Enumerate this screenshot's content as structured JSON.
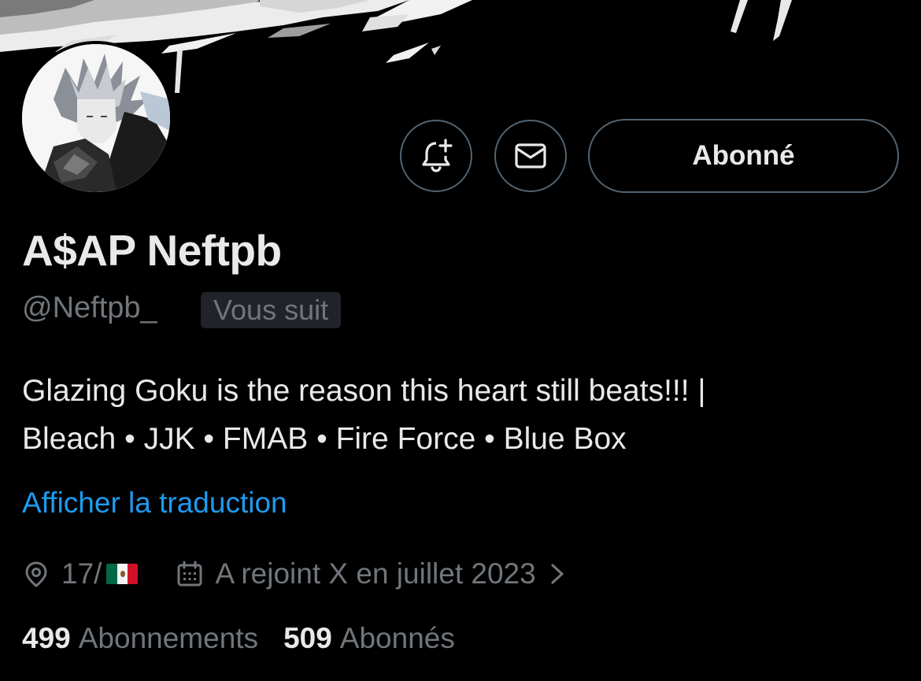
{
  "profile": {
    "display_name": "A$AP Neftpb",
    "handle": "@Neftpb_",
    "follows_you_badge": "Vous suit",
    "bio_line1": "Glazing Goku is the reason this heart still beats!!! |",
    "bio_line2": "Bleach • JJK • FMAB • Fire Force • Blue Box",
    "translate_link": "Afficher la traduction",
    "location": "17/",
    "location_flag": "mexico-flag",
    "joined": "A rejoint X en juillet 2023",
    "following_count": "499",
    "following_label": "Abonnements",
    "followers_count": "509",
    "followers_label": "Abonnés"
  },
  "actions": {
    "follow_button_label": "Abonné",
    "notify_icon": "bell-plus-icon",
    "message_icon": "envelope-icon"
  },
  "colors": {
    "background": "#000000",
    "primary_text": "#e7e9ea",
    "secondary_text": "#71767b",
    "link": "#1d9bf0",
    "button_border": "#536471",
    "badge_bg": "#202327"
  }
}
